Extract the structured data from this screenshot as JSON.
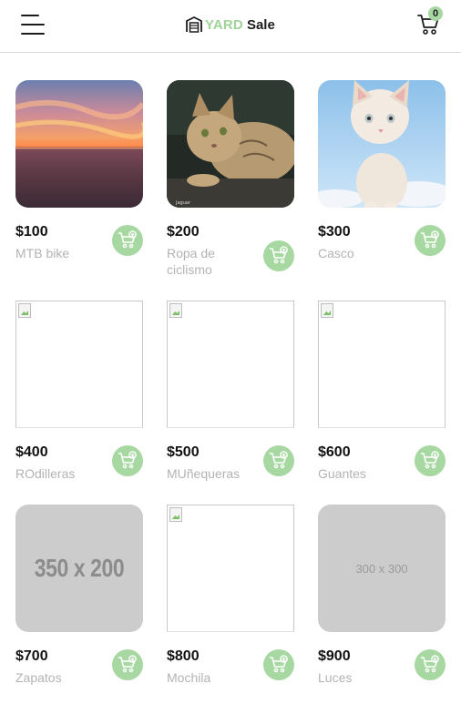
{
  "header": {
    "logo_yard": "YARD",
    "logo_sale": "Sale",
    "cart_count": "0"
  },
  "colors": {
    "accent_green": "#a8d8a2",
    "logo_green": "#9fd39a",
    "text_dark": "#111111",
    "text_muted": "#b3b3b3",
    "placeholder_gray": "#cccccc"
  },
  "products": [
    {
      "price": "$100",
      "name": "MTB bike",
      "image": "sunset-photo"
    },
    {
      "price": "$200",
      "name": "Ropa de ciclismo",
      "image": "sand-cat-photo"
    },
    {
      "price": "$300",
      "name": "Casco",
      "image": "kitten-photo"
    },
    {
      "price": "$400",
      "name": "ROdilleras",
      "image": "broken-image"
    },
    {
      "price": "$500",
      "name": "MUñequeras",
      "image": "broken-image"
    },
    {
      "price": "$600",
      "name": "Guantes",
      "image": "broken-image"
    },
    {
      "price": "$700",
      "name": "Zapatos",
      "image": "placeholder",
      "placeholder_text": "350 x 200"
    },
    {
      "price": "$800",
      "name": "Mochila",
      "image": "broken-image"
    },
    {
      "price": "$900",
      "name": "Luces",
      "image": "placeholder",
      "placeholder_text": "300 x 300"
    }
  ],
  "icons": {
    "menu": "hamburger-icon",
    "logo": "garage-icon",
    "cart": "cart-icon",
    "add": "cart-plus-icon",
    "broken": "broken-image-icon"
  }
}
